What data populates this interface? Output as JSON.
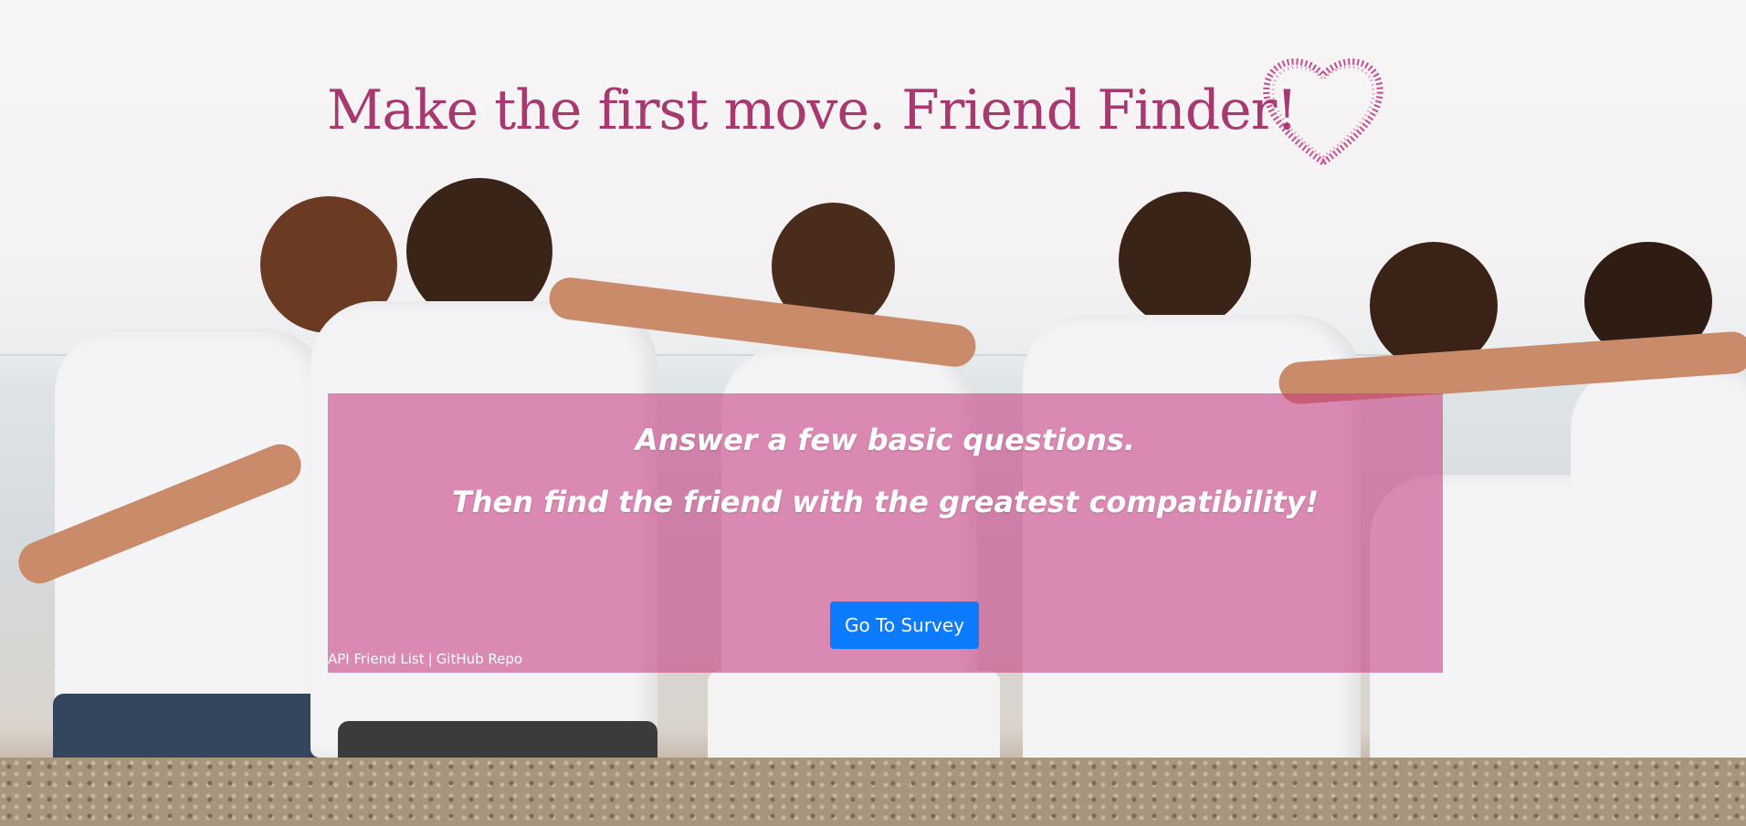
{
  "hero": {
    "title": "Make the first move. Friend Finder!",
    "heart_icon": "heart-icon",
    "background": "group-of-friends-on-beach"
  },
  "panel": {
    "line1": "Answer a few basic questions.",
    "line2": "Then find the friend with the greatest compatibility!",
    "survey_button": "Go To Survey"
  },
  "footer": {
    "api_link": "API Friend List",
    "separator": "|",
    "github_link": "GitHub Repo"
  },
  "colors": {
    "title": "#a8396f",
    "panel": "#c83c82",
    "button": "#0d7bff"
  }
}
